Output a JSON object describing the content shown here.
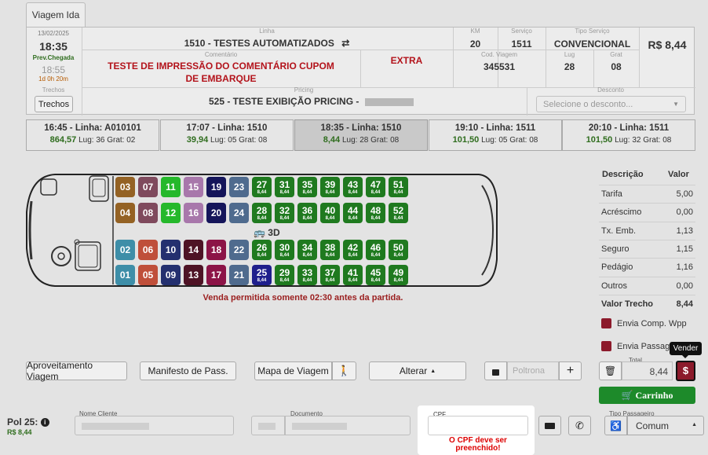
{
  "tab": {
    "label": "Viagem Ida"
  },
  "header": {
    "date": "13/02/2025",
    "depart_time": "18:35",
    "prev_chegada_label": "Prev.Chegada",
    "arrival_time": "18:55",
    "duration": "1d 0h 20m",
    "linha_label": "Linha",
    "linha_value": "1510 - TESTES AUTOMATIZADOS",
    "comentario_label": "Comentário",
    "comentario_value": "TESTE DE IMPRESSÃO DO COMENTÁRIO CUPOM DE EMBARQUE",
    "extra": "EXTRA",
    "km_label": "KM",
    "km_value": "20",
    "servico_label": "Serviço",
    "servico_value": "1511",
    "tipo_servico_label": "Tipo Serviço",
    "tipo_servico_value": "CONVENCIONAL",
    "price": "R$ 8,44",
    "cod_viagem_label": "Cod. Viagem",
    "cod_viagem_value": "345531",
    "lug_label": "Lug",
    "lug_value": "28",
    "grat_label": "Grat",
    "grat_value": "08",
    "trechos_label": "Trechos",
    "trechos_button": "Trechos",
    "pricing_label": "Pricing",
    "pricing_value": "525 - TESTE EXIBIÇÃO PRICING -",
    "desconto_label": "Desconto",
    "desconto_placeholder": "Selecione o desconto..."
  },
  "trips": [
    {
      "title": "16:45 - Linha: A010101",
      "price": "864,57",
      "info": "Lug: 36 Grat: 02",
      "selected": false
    },
    {
      "title": "17:07 - Linha: 1510",
      "price": "39,94",
      "info": "Lug: 05 Grat: 08",
      "selected": false
    },
    {
      "title": "18:35 - Linha: 1510",
      "price": "8,44",
      "info": "Lug: 28 Grat: 08",
      "selected": true
    },
    {
      "title": "19:10 - Linha: 1511",
      "price": "101,50",
      "info": "Lug: 05 Grat: 08",
      "selected": false
    },
    {
      "title": "20:10 - Linha: 1511",
      "price": "101,50",
      "info": "Lug: 32 Grat: 08",
      "selected": false
    }
  ],
  "seats": [
    {
      "n": "03",
      "c": "#946224",
      "r": 0,
      "i": 0
    },
    {
      "n": "07",
      "c": "#7f4a5d",
      "r": 0,
      "i": 1
    },
    {
      "n": "11",
      "c": "#25b82b",
      "r": 0,
      "i": 2
    },
    {
      "n": "15",
      "c": "#a877ab",
      "r": 0,
      "i": 3
    },
    {
      "n": "19",
      "c": "#15155a",
      "r": 0,
      "i": 4
    },
    {
      "n": "23",
      "c": "#4f6b8e",
      "r": 0,
      "i": 5
    },
    {
      "n": "27",
      "c": "#1f7a1f",
      "r": 0,
      "i": 6,
      "p": "8,44"
    },
    {
      "n": "31",
      "c": "#1f7a1f",
      "r": 0,
      "i": 7,
      "p": "8,44"
    },
    {
      "n": "35",
      "c": "#1f7a1f",
      "r": 0,
      "i": 8,
      "p": "8,44"
    },
    {
      "n": "39",
      "c": "#1f7a1f",
      "r": 0,
      "i": 9,
      "p": "8,44"
    },
    {
      "n": "43",
      "c": "#1f7a1f",
      "r": 0,
      "i": 10,
      "p": "8,44"
    },
    {
      "n": "47",
      "c": "#1f7a1f",
      "r": 0,
      "i": 11,
      "p": "8,44"
    },
    {
      "n": "51",
      "c": "#1f7a1f",
      "r": 0,
      "i": 12,
      "p": "8,44"
    },
    {
      "n": "04",
      "c": "#946224",
      "r": 1,
      "i": 0
    },
    {
      "n": "08",
      "c": "#7f4a5d",
      "r": 1,
      "i": 1
    },
    {
      "n": "12",
      "c": "#25b82b",
      "r": 1,
      "i": 2
    },
    {
      "n": "16",
      "c": "#a877ab",
      "r": 1,
      "i": 3
    },
    {
      "n": "20",
      "c": "#15155a",
      "r": 1,
      "i": 4
    },
    {
      "n": "24",
      "c": "#4f6b8e",
      "r": 1,
      "i": 5
    },
    {
      "n": "28",
      "c": "#1f7a1f",
      "r": 1,
      "i": 6,
      "p": "8,44"
    },
    {
      "n": "32",
      "c": "#1f7a1f",
      "r": 1,
      "i": 7,
      "p": "8,44"
    },
    {
      "n": "36",
      "c": "#1f7a1f",
      "r": 1,
      "i": 8,
      "p": "8,44"
    },
    {
      "n": "40",
      "c": "#1f7a1f",
      "r": 1,
      "i": 9,
      "p": "8,44"
    },
    {
      "n": "44",
      "c": "#1f7a1f",
      "r": 1,
      "i": 10,
      "p": "8,44"
    },
    {
      "n": "48",
      "c": "#1f7a1f",
      "r": 1,
      "i": 11,
      "p": "8,44"
    },
    {
      "n": "52",
      "c": "#1f7a1f",
      "r": 1,
      "i": 12,
      "p": "8,44"
    },
    {
      "n": "02",
      "c": "#3e8ea8",
      "r": 2,
      "i": 0
    },
    {
      "n": "06",
      "c": "#bf4f3a",
      "r": 2,
      "i": 1
    },
    {
      "n": "10",
      "c": "#24306f",
      "r": 2,
      "i": 2
    },
    {
      "n": "14",
      "c": "#4e1325",
      "r": 2,
      "i": 3
    },
    {
      "n": "18",
      "c": "#8c1447",
      "r": 2,
      "i": 4
    },
    {
      "n": "22",
      "c": "#4f6b8e",
      "r": 2,
      "i": 5
    },
    {
      "n": "26",
      "c": "#1f7a1f",
      "r": 2,
      "i": 6,
      "p": "8,44"
    },
    {
      "n": "30",
      "c": "#1f7a1f",
      "r": 2,
      "i": 7,
      "p": "8,44"
    },
    {
      "n": "34",
      "c": "#1f7a1f",
      "r": 2,
      "i": 8,
      "p": "8,44"
    },
    {
      "n": "38",
      "c": "#1f7a1f",
      "r": 2,
      "i": 9,
      "p": "8,44"
    },
    {
      "n": "42",
      "c": "#1f7a1f",
      "r": 2,
      "i": 10,
      "p": "8,44"
    },
    {
      "n": "46",
      "c": "#1f7a1f",
      "r": 2,
      "i": 11,
      "p": "8,44"
    },
    {
      "n": "50",
      "c": "#1f7a1f",
      "r": 2,
      "i": 12,
      "p": "8,44"
    },
    {
      "n": "01",
      "c": "#3e8ea8",
      "r": 3,
      "i": 0
    },
    {
      "n": "05",
      "c": "#bf4f3a",
      "r": 3,
      "i": 1
    },
    {
      "n": "09",
      "c": "#24306f",
      "r": 3,
      "i": 2
    },
    {
      "n": "13",
      "c": "#4e1325",
      "r": 3,
      "i": 3
    },
    {
      "n": "17",
      "c": "#8c1447",
      "r": 3,
      "i": 4
    },
    {
      "n": "21",
      "c": "#4f6b8e",
      "r": 3,
      "i": 5
    },
    {
      "n": "25",
      "c": "#1f1f8c",
      "r": 3,
      "i": 6,
      "p": "8,44"
    },
    {
      "n": "29",
      "c": "#1f7a1f",
      "r": 3,
      "i": 7,
      "p": "8,44"
    },
    {
      "n": "33",
      "c": "#1f7a1f",
      "r": 3,
      "i": 8,
      "p": "8,44"
    },
    {
      "n": "37",
      "c": "#1f7a1f",
      "r": 3,
      "i": 9,
      "p": "8,44"
    },
    {
      "n": "41",
      "c": "#1f7a1f",
      "r": 3,
      "i": 10,
      "p": "8,44"
    },
    {
      "n": "45",
      "c": "#1f7a1f",
      "r": 3,
      "i": 11,
      "p": "8,44"
    },
    {
      "n": "49",
      "c": "#1f7a1f",
      "r": 3,
      "i": 12,
      "p": "8,44"
    }
  ],
  "bus": {
    "label": "3D"
  },
  "warning": "Venda permitida somente 02:30 antes da partida.",
  "summary": {
    "desc_header": "Descrição",
    "valor_header": "Valor",
    "rows": [
      {
        "label": "Tarifa",
        "value": "5,00"
      },
      {
        "label": "Acréscimo",
        "value": "0,00"
      },
      {
        "label": "Tx. Emb.",
        "value": "1,13"
      },
      {
        "label": "Seguro",
        "value": "1,15"
      },
      {
        "label": "Pedágio",
        "value": "1,16"
      },
      {
        "label": "Outros",
        "value": "0,00"
      }
    ],
    "total_label": "Valor Trecho",
    "total_value": "8,44",
    "envia_wpp": "Envia Comp. Wpp",
    "envia_passagem": "Envia Passage"
  },
  "actions": {
    "aproveitamento": "Aproveitamento Viagem",
    "manifesto": "Manifesto de Pass.",
    "mapa": "Mapa de Viagem",
    "alterar": "Alterar",
    "poltrona_placeholder": "Poltrona",
    "total_label": "Total",
    "total_value": "8,44",
    "vender_tooltip": "Vender",
    "carrinho": "Carrinho"
  },
  "passenger": {
    "pol": "Pol 25:",
    "price": "R$ 8,44",
    "nome_label": "Nome Cliente",
    "documento_label": "Documento",
    "cpf_label": "CPF",
    "cpf_error": "O CPF deve ser preenchido!",
    "tipo_label": "Tipo Passageiro",
    "tipo_value": "Comum"
  }
}
